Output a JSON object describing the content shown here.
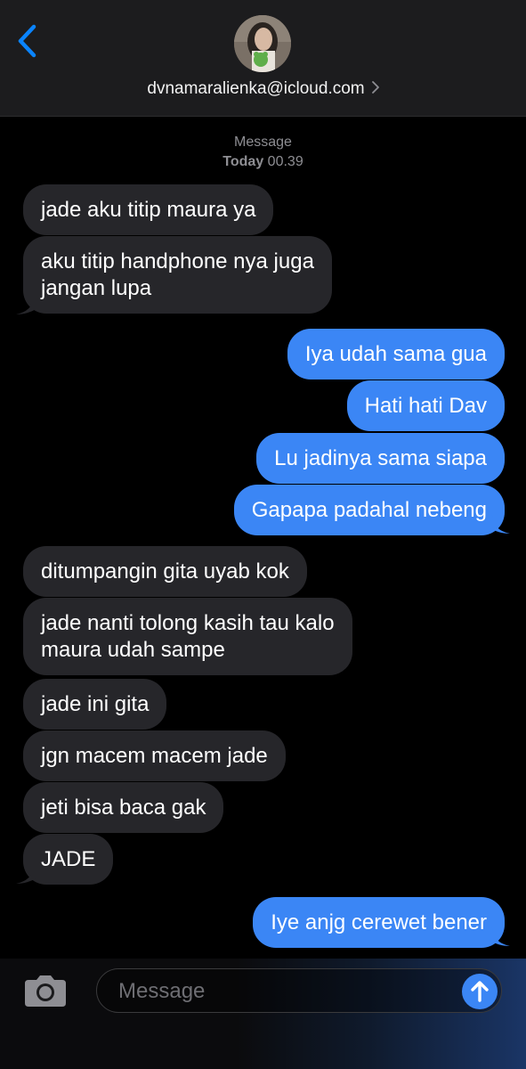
{
  "header": {
    "contact": "dvnamaralienka@icloud.com"
  },
  "stamp": {
    "label": "Message",
    "day": "Today",
    "time": "00.39"
  },
  "messages": [
    {
      "dir": "in",
      "text": "jade aku titip maura ya"
    },
    {
      "dir": "in",
      "text": "aku titip handphone nya juga",
      "text2": "jangan lupa"
    },
    {
      "dir": "out",
      "text": "Iya udah sama gua"
    },
    {
      "dir": "out",
      "text": "Hati hati Dav"
    },
    {
      "dir": "out",
      "text": "Lu jadinya sama siapa"
    },
    {
      "dir": "out",
      "text": "Gapapa padahal nebeng"
    },
    {
      "dir": "in",
      "text": "ditumpangin gita uyab kok"
    },
    {
      "dir": "in",
      "text": "jade nanti tolong kasih tau kalo",
      "text2": "maura udah sampe"
    },
    {
      "dir": "in",
      "text": "jade ini gita"
    },
    {
      "dir": "in",
      "text": "jgn macem macem jade"
    },
    {
      "dir": "in",
      "text": "jeti bisa baca gak"
    },
    {
      "dir": "in",
      "text": "JADE"
    },
    {
      "dir": "out",
      "text": "Iye anjg cerewet bener"
    }
  ],
  "composer": {
    "placeholder": "Message"
  },
  "colors": {
    "incoming": "#26262a",
    "outgoing": "#3b86f5",
    "accent": "#0a84ff"
  },
  "icons": [
    "chevron-left-icon",
    "chevron-right-icon",
    "camera-icon",
    "arrow-up-icon"
  ]
}
